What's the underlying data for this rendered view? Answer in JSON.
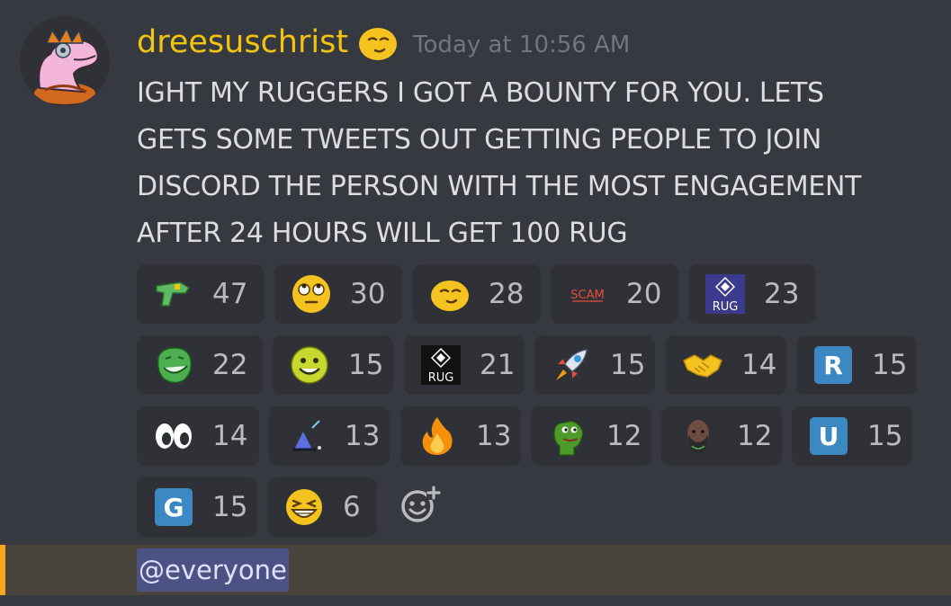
{
  "message": {
    "username": "dreesuschrist",
    "username_color": "#f1c40f",
    "timestamp": "Today at 10:56 AM",
    "lines": [
      "IGHT MY RUGGERS I GOT A BOUNTY FOR YOU. LETS",
      "GETS SOME TWEETS OUT GETTING PEOPLE TO JOIN",
      "DISCORD THE PERSON WITH THE MOST ENGAGEMENT",
      "AFTER 24 HOURS WILL GET 100 RUG"
    ],
    "mention": "@everyone"
  },
  "reactions": [
    {
      "emoji": "raygun-icon",
      "count": "47"
    },
    {
      "emoji": "rolling-eyes-icon",
      "count": "30"
    },
    {
      "emoji": "smirk-moon-icon",
      "count": "28"
    },
    {
      "emoji": "scam-text-icon",
      "label": "SCAM",
      "count": "20"
    },
    {
      "emoji": "rug-logo-blue-icon",
      "label": "RUG",
      "count": "23"
    },
    {
      "emoji": "trollface-icon",
      "count": "22"
    },
    {
      "emoji": "green-smiley-icon",
      "count": "15"
    },
    {
      "emoji": "rug-logo-black-icon",
      "label": "RUG",
      "count": "21"
    },
    {
      "emoji": "rocket-icon",
      "count": "15"
    },
    {
      "emoji": "handshake-icon",
      "count": "14"
    },
    {
      "emoji": "letter-r-icon",
      "label": "R",
      "count": "15"
    },
    {
      "emoji": "eyes-icon",
      "count": "14"
    },
    {
      "emoji": "wizard-icon",
      "count": "13"
    },
    {
      "emoji": "fire-icon",
      "count": "13"
    },
    {
      "emoji": "pepe-icon",
      "count": "12"
    },
    {
      "emoji": "bearded-man-icon",
      "count": "12"
    },
    {
      "emoji": "letter-u-icon",
      "label": "U",
      "count": "15"
    },
    {
      "emoji": "letter-g-icon",
      "label": "G",
      "count": "15"
    },
    {
      "emoji": "grin-squint-icon",
      "count": "6"
    }
  ],
  "colors": {
    "background": "#36393f",
    "reaction_bg": "#2f3136",
    "mention_row_bg": "#49443c",
    "mention_border": "#faa61a",
    "mention_pill_bg": "#4d5285"
  }
}
